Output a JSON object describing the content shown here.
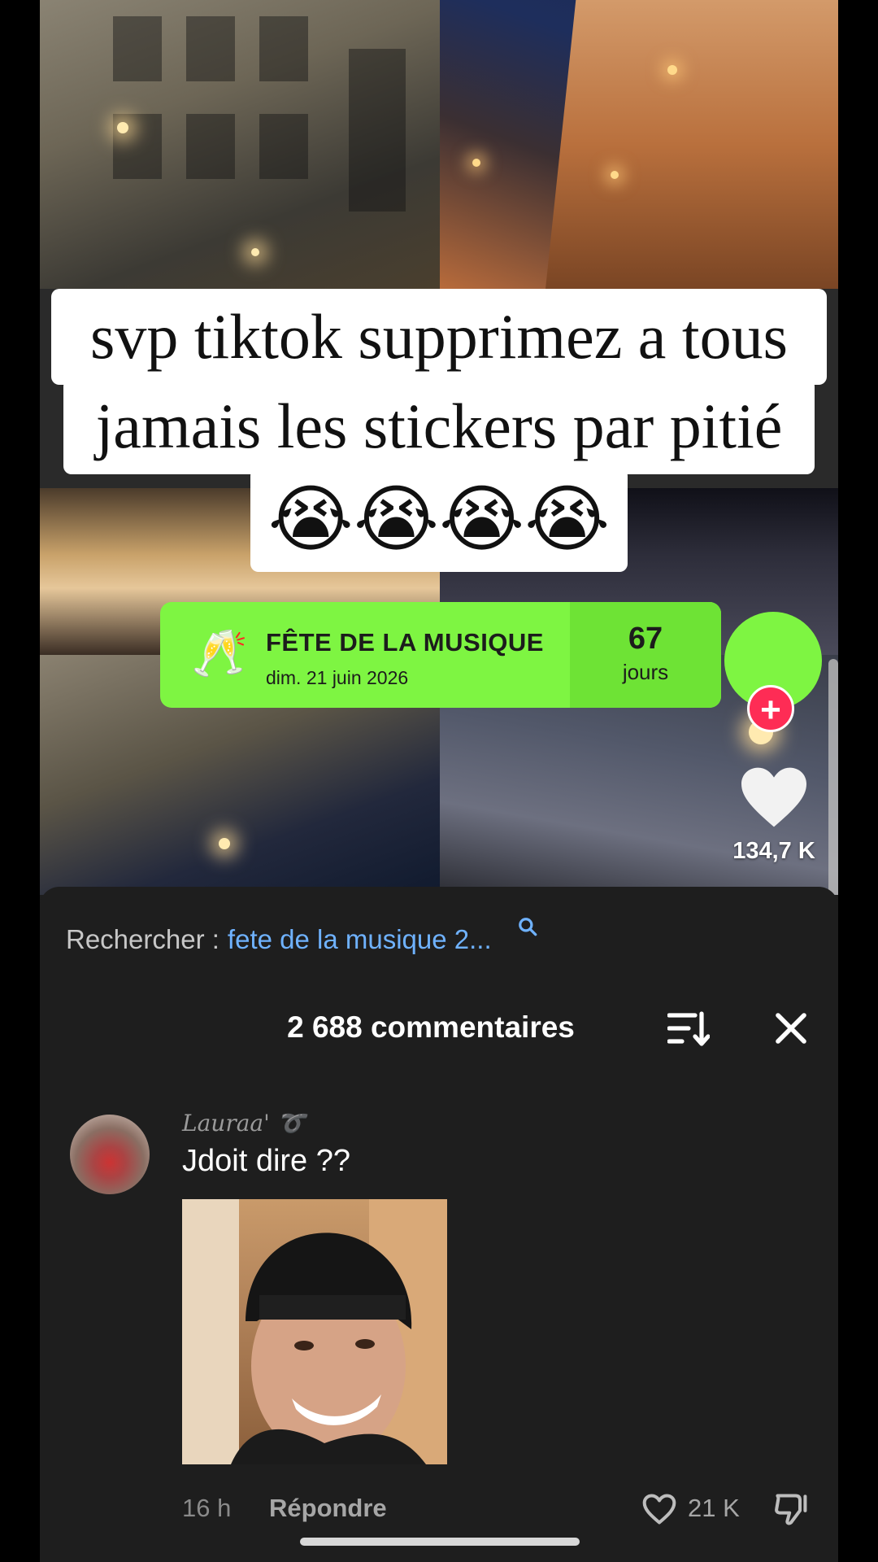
{
  "caption": {
    "line1": "svp tiktok supprimez a tous",
    "line2": "jamais les stickers par pitié",
    "emojis": "😭😭😭😭"
  },
  "countdown": {
    "icon": "🥂",
    "title": "FÊTE DE LA MUSIQUE",
    "date": "dim. 21 juin 2026",
    "value": "67",
    "unit": "jours",
    "color": "#7ef542"
  },
  "rail": {
    "follow_plus": "+",
    "like_count": "134,7 K",
    "accent": "#fe2c55"
  },
  "comments": {
    "search_label": "Rechercher :",
    "search_query": "fete de la musique 2...",
    "title": "2 688 commentaires",
    "items": [
      {
        "username": "Lauraa' ➰",
        "text": "Jdoit dire ??",
        "time": "16 h",
        "reply_label": "Répondre",
        "like_count": "21 K"
      }
    ]
  }
}
